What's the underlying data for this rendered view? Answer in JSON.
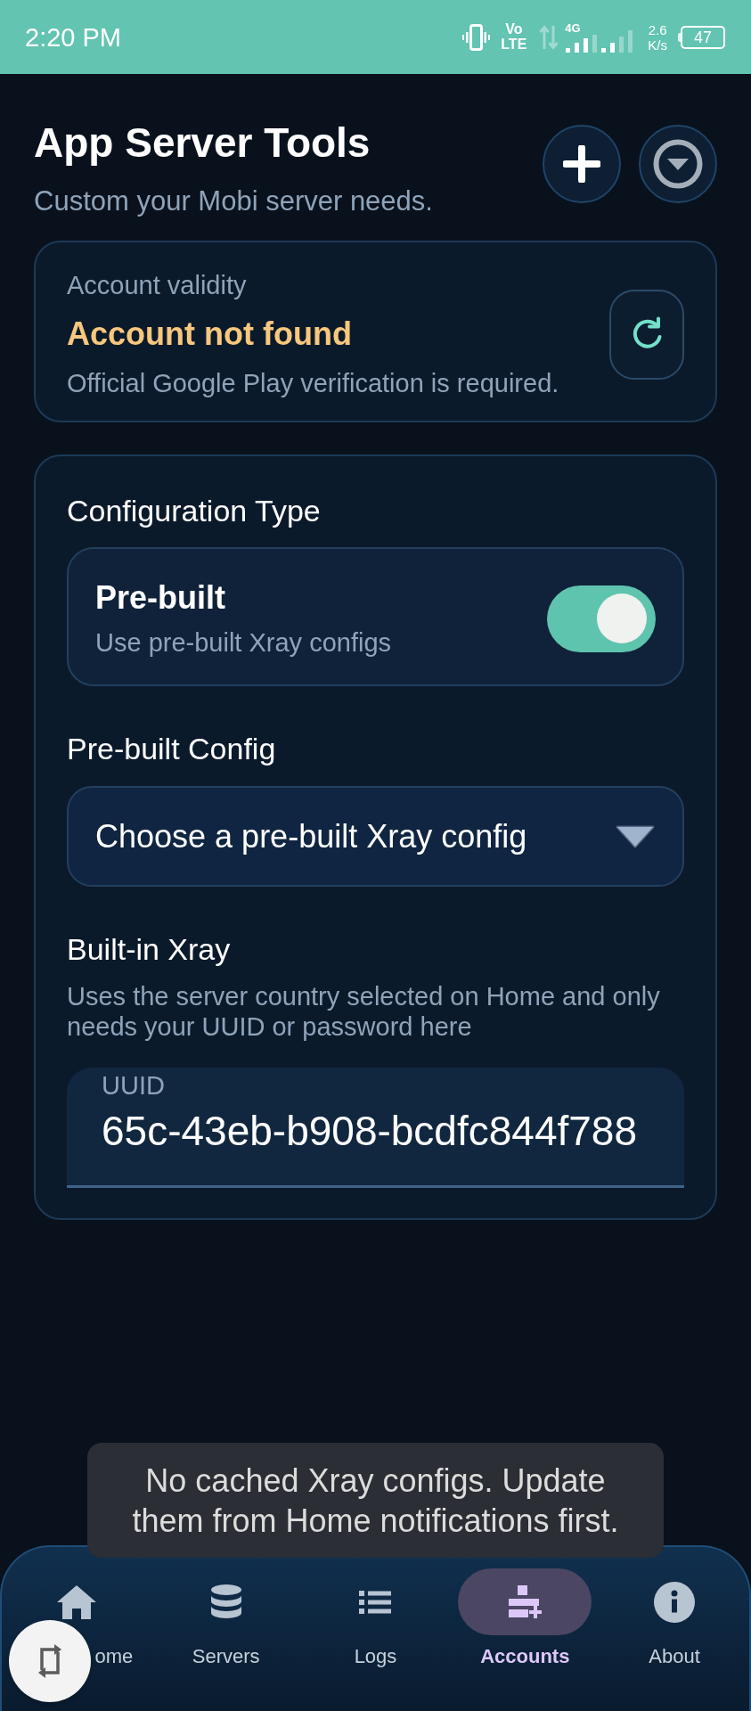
{
  "status_bar": {
    "time": "2:20 PM",
    "volte_top": "Vo",
    "volte_bottom": "LTE",
    "network_type": "4G",
    "speed_value": "2.6",
    "speed_unit": "K/s",
    "battery": "47"
  },
  "header": {
    "title": "App Server Tools",
    "subtitle": "Custom your Mobi server needs."
  },
  "account_card": {
    "label": "Account validity",
    "status": "Account not found",
    "note": "Official Google Play verification is required."
  },
  "config_card": {
    "section_title": "Configuration Type",
    "toggle_row": {
      "title": "Pre-built",
      "description": "Use pre-built Xray configs",
      "on": true
    },
    "dropdown_label": "Pre-built Config",
    "dropdown": {
      "placeholder": "Choose a pre-built Xray config"
    },
    "builtin_title": "Built-in Xray",
    "builtin_description": "Uses the server country selected on Home and only needs your UUID or password here",
    "uuid_field": {
      "label": "UUID",
      "value": "65c-43eb-b908-bcdfc844f788"
    }
  },
  "toast": {
    "message": "No cached Xray configs. Update them from Home notifications first."
  },
  "bottom_nav": {
    "items": [
      {
        "kind": "home",
        "label": "ome",
        "selected": false
      },
      {
        "kind": "servers",
        "label": "Servers",
        "selected": false
      },
      {
        "kind": "logs",
        "label": "Logs",
        "selected": false
      },
      {
        "kind": "accounts",
        "label": "Accounts",
        "selected": true
      },
      {
        "kind": "about",
        "label": "About",
        "selected": false
      }
    ]
  }
}
